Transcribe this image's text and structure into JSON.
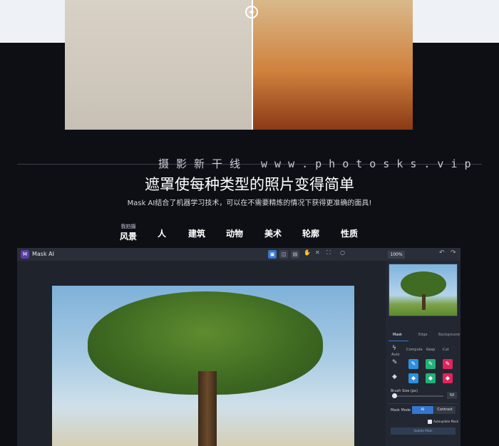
{
  "watermark": "摄影新干线  www.photosks.vip",
  "headline": "遮罩使每种类型的照片变得简单",
  "subline": "Mask AI结合了机器学习技术，可以在不需要精炼的情况下获得更准确的面具!",
  "categories": {
    "first_small": "我拍摄",
    "first_big": "风景",
    "items": [
      "人",
      "建筑",
      "动物",
      "美术",
      "轮廓",
      "性质"
    ]
  },
  "app": {
    "title": "Mask AI",
    "logo_glyph": "M",
    "zoom": "100%",
    "panel": {
      "tabs": [
        "Mask",
        "Edge",
        "Background"
      ],
      "tool_labels": [
        "Compute",
        "Keep",
        "Cut"
      ],
      "auto_label": "Auto",
      "brush_size_label": "Brush Size (px)",
      "brush_size_value": "50",
      "mask_mode_label": "Mask Mode",
      "mode_ai": "AI",
      "mode_contrast": "Contrast",
      "autoupdate_label": "Autoupdate Mask",
      "update_button": "Update Mask"
    }
  },
  "colors": {
    "accent": "#3476d1",
    "compute": "#2d8fe0",
    "keep": "#21b27a",
    "cut": "#e0245e"
  }
}
